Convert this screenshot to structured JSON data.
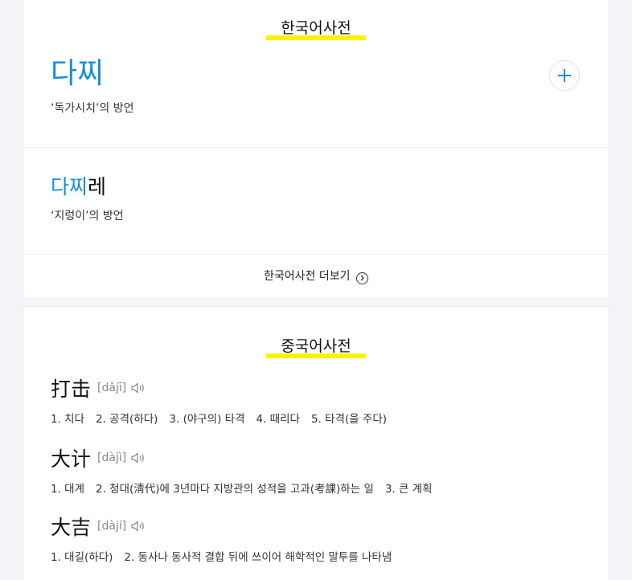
{
  "korean_dict": {
    "section_title": "한국어사전",
    "entries": [
      {
        "word_highlight": "다찌",
        "word_rest": "",
        "definition": "‘독가시치’의 방언"
      },
      {
        "word_highlight": "다찌",
        "word_rest": "레",
        "definition": "‘지렁이’의 방언"
      }
    ],
    "more_label": "한국어사전 더보기"
  },
  "chinese_dict": {
    "section_title": "중국어사전",
    "entries": [
      {
        "word": "打击",
        "pinyin": "[dǎjī]",
        "meanings": [
          "1. 치다",
          "2. 공격(하다)",
          "3. (야구의) 타격",
          "4. 때리다",
          "5. 타격(을 주다)"
        ]
      },
      {
        "word": "大计",
        "pinyin": "[dàjì]",
        "meanings": [
          "1. 대계",
          "2. 청대(淸代)에 3년마다 지방관의 성적을 고과(考課)하는 일",
          "3. 큰 계획"
        ]
      },
      {
        "word": "大吉",
        "pinyin": "[dàjí]",
        "meanings": [
          "1. 대길(하다)",
          "2. 동사나 동사적 결합 뒤에 쓰이어 해학적인 말투를 나타냄"
        ]
      }
    ]
  },
  "icons": {
    "add": "plus-icon",
    "more": "chevron-right-circle-icon",
    "pronounce": "speaker-icon"
  },
  "colors": {
    "accent": "#1a8fd8",
    "highlight": "#fff200"
  }
}
